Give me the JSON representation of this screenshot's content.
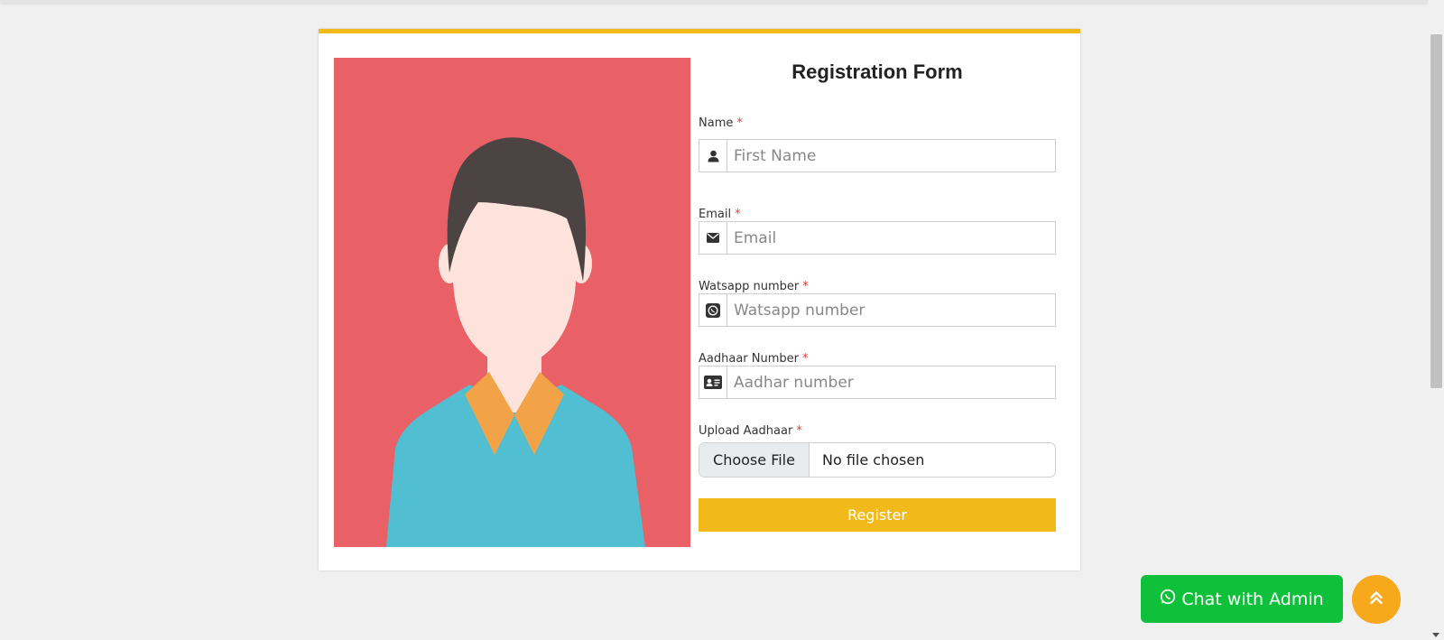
{
  "form": {
    "title": "Registration Form",
    "required_marker": "*",
    "fields": {
      "name": {
        "label": "Name",
        "placeholder": "First Name",
        "icon": "user-icon"
      },
      "email": {
        "label": "Email",
        "placeholder": "Email",
        "icon": "envelope-icon"
      },
      "whatsapp": {
        "label": "Watsapp number",
        "placeholder": "Watsapp number",
        "icon": "whatsapp-icon"
      },
      "aadhaar": {
        "label": "Aadhaar Number",
        "placeholder": "Aadhar number",
        "icon": "id-card-icon"
      }
    },
    "upload": {
      "label": "Upload Aadhaar",
      "button_label": "Choose File",
      "status": "No file chosen"
    },
    "submit_label": "Register"
  },
  "floating": {
    "chat_label": "Chat with Admin",
    "chat_icon": "whatsapp-icon",
    "scroll_top_icon": "double-chevron-up-icon"
  },
  "colors": {
    "accent": "#f2b91b",
    "chat_green": "#0fc13a",
    "scroll_top": "#f7a81b",
    "avatar_background": "#e96067",
    "required": "#e53935"
  }
}
